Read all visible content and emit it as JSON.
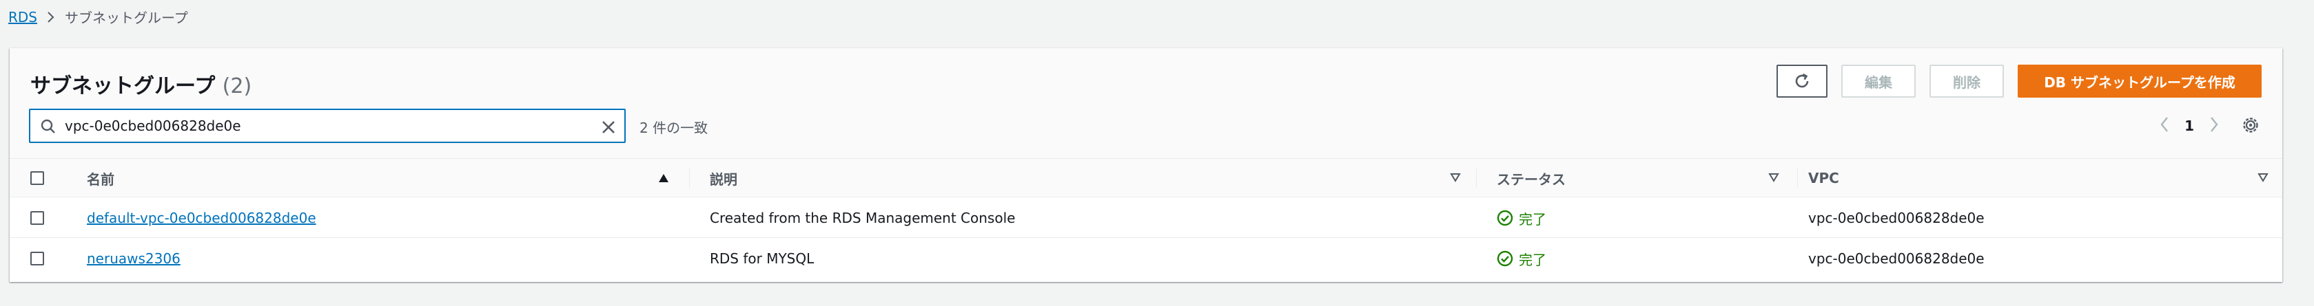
{
  "breadcrumb": {
    "root": "RDS",
    "current": "サブネットグループ"
  },
  "panel": {
    "title": "サブネットグループ",
    "count": "(2)",
    "buttons": {
      "edit": "編集",
      "delete": "削除",
      "create": "DB サブネットグループを作成"
    },
    "search": {
      "value": "vpc-0e0cbed006828de0e",
      "match_text": "2 件の一致"
    },
    "pagination": {
      "page": "1"
    }
  },
  "table": {
    "headers": {
      "name": "名前",
      "description": "説明",
      "status": "ステータス",
      "vpc": "VPC"
    },
    "rows": [
      {
        "name": "default-vpc-0e0cbed006828de0e",
        "description": "Created from the RDS Management Console",
        "status": "完了",
        "vpc": "vpc-0e0cbed006828de0e"
      },
      {
        "name": "neruaws2306",
        "description": "RDS for MYSQL",
        "status": "完了",
        "vpc": "vpc-0e0cbed006828de0e"
      }
    ]
  },
  "colors": {
    "link": "#0073bb",
    "primary": "#ec7211",
    "success": "#1d8102"
  },
  "icons": [
    "chevron-right-icon",
    "refresh-icon",
    "search-icon",
    "clear-icon",
    "chevron-left-icon",
    "gear-icon",
    "sort-ascending-icon",
    "sort-icon",
    "status-success-icon"
  ]
}
